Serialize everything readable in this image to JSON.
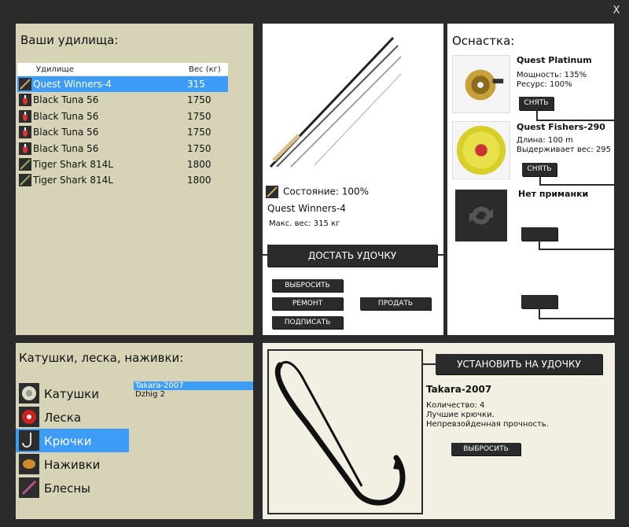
{
  "window": {
    "close_label": "X"
  },
  "rods": {
    "title": "Ваши удилища:",
    "col_name": "Удилище",
    "col_weight": "Вес (кг)",
    "items": [
      {
        "name": "Quest Winners-4",
        "weight": "315",
        "icon": "rod-icon"
      },
      {
        "name": "Black Tuna 56",
        "weight": "1750",
        "icon": "bobber-icon"
      },
      {
        "name": "Black Tuna 56",
        "weight": "1750",
        "icon": "bobber-icon"
      },
      {
        "name": "Black Tuna 56",
        "weight": "1750",
        "icon": "bobber-icon"
      },
      {
        "name": "Black Tuna 56",
        "weight": "1750",
        "icon": "bobber-icon"
      },
      {
        "name": "Tiger Shark 814L",
        "weight": "1800",
        "icon": "rod-icon"
      },
      {
        "name": "Tiger Shark 814L",
        "weight": "1800",
        "icon": "rod-icon"
      }
    ]
  },
  "rod_info": {
    "state": "Состояние: 100%",
    "name": "Quest Winners-4",
    "max_weight": "Макс. вес: 315 кг",
    "get_button": "ДОСТАТЬ УДОЧКУ",
    "drop_button": "ВЫБРОСИТЬ",
    "repair_button": "РЕМОНТ",
    "sign_button": "ПОДПИСАТЬ",
    "sell_button": "ПРОДАТЬ"
  },
  "tackle": {
    "title": "Оснастка:",
    "reel": {
      "name": "Quest Platinum",
      "line1": "Мощность: 135%",
      "line2": "Ресурс: 100%",
      "button": "СНЯТЬ"
    },
    "line": {
      "name": "Quest Fishers-290",
      "line1": "Длина: 100 m",
      "line2": "Выдерживает вес: 295",
      "button": "СНЯТЬ"
    },
    "bait": {
      "name": "Нет приманки"
    }
  },
  "categories": {
    "title": "Катушки, леска, наживки:",
    "items": [
      {
        "label": "Катушки",
        "icon": "reel-icon"
      },
      {
        "label": "Леска",
        "icon": "line-spool-icon"
      },
      {
        "label": "Крючки",
        "icon": "hook-icon"
      },
      {
        "label": "Наживки",
        "icon": "bait-icon"
      },
      {
        "label": "Блесны",
        "icon": "spoon-lure-icon"
      }
    ],
    "selected": 2,
    "list": [
      "Takara-2007",
      "Dzhig 2"
    ]
  },
  "detail": {
    "install_button": "УСТАНОВИТЬ НА УДОЧКУ",
    "name": "Takara-2007",
    "line1": "Количество: 4",
    "line2": "Лучшие крючки.",
    "line3": "Непревзойденная прочность.",
    "drop_button": "ВЫБРОСИТЬ"
  },
  "colors": {
    "selection": "#3d9cf5",
    "panel_beige": "#d7d3b7",
    "dark": "#2b2b2b"
  }
}
